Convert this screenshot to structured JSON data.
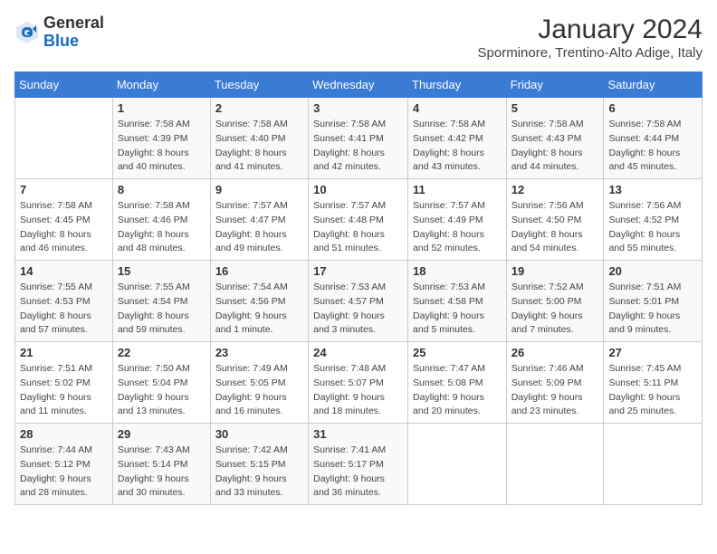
{
  "header": {
    "logo_line1": "General",
    "logo_line2": "Blue",
    "month_year": "January 2024",
    "location": "Sporminore, Trentino-Alto Adige, Italy"
  },
  "days_of_week": [
    "Sunday",
    "Monday",
    "Tuesday",
    "Wednesday",
    "Thursday",
    "Friday",
    "Saturday"
  ],
  "weeks": [
    [
      {
        "day": "",
        "sunrise": "",
        "sunset": "",
        "daylight": ""
      },
      {
        "day": "1",
        "sunrise": "7:58 AM",
        "sunset": "4:39 PM",
        "daylight": "8 hours and 40 minutes."
      },
      {
        "day": "2",
        "sunrise": "7:58 AM",
        "sunset": "4:40 PM",
        "daylight": "8 hours and 41 minutes."
      },
      {
        "day": "3",
        "sunrise": "7:58 AM",
        "sunset": "4:41 PM",
        "daylight": "8 hours and 42 minutes."
      },
      {
        "day": "4",
        "sunrise": "7:58 AM",
        "sunset": "4:42 PM",
        "daylight": "8 hours and 43 minutes."
      },
      {
        "day": "5",
        "sunrise": "7:58 AM",
        "sunset": "4:43 PM",
        "daylight": "8 hours and 44 minutes."
      },
      {
        "day": "6",
        "sunrise": "7:58 AM",
        "sunset": "4:44 PM",
        "daylight": "8 hours and 45 minutes."
      }
    ],
    [
      {
        "day": "7",
        "sunrise": "7:58 AM",
        "sunset": "4:45 PM",
        "daylight": "8 hours and 46 minutes."
      },
      {
        "day": "8",
        "sunrise": "7:58 AM",
        "sunset": "4:46 PM",
        "daylight": "8 hours and 48 minutes."
      },
      {
        "day": "9",
        "sunrise": "7:57 AM",
        "sunset": "4:47 PM",
        "daylight": "8 hours and 49 minutes."
      },
      {
        "day": "10",
        "sunrise": "7:57 AM",
        "sunset": "4:48 PM",
        "daylight": "8 hours and 51 minutes."
      },
      {
        "day": "11",
        "sunrise": "7:57 AM",
        "sunset": "4:49 PM",
        "daylight": "8 hours and 52 minutes."
      },
      {
        "day": "12",
        "sunrise": "7:56 AM",
        "sunset": "4:50 PM",
        "daylight": "8 hours and 54 minutes."
      },
      {
        "day": "13",
        "sunrise": "7:56 AM",
        "sunset": "4:52 PM",
        "daylight": "8 hours and 55 minutes."
      }
    ],
    [
      {
        "day": "14",
        "sunrise": "7:55 AM",
        "sunset": "4:53 PM",
        "daylight": "8 hours and 57 minutes."
      },
      {
        "day": "15",
        "sunrise": "7:55 AM",
        "sunset": "4:54 PM",
        "daylight": "8 hours and 59 minutes."
      },
      {
        "day": "16",
        "sunrise": "7:54 AM",
        "sunset": "4:56 PM",
        "daylight": "9 hours and 1 minute."
      },
      {
        "day": "17",
        "sunrise": "7:53 AM",
        "sunset": "4:57 PM",
        "daylight": "9 hours and 3 minutes."
      },
      {
        "day": "18",
        "sunrise": "7:53 AM",
        "sunset": "4:58 PM",
        "daylight": "9 hours and 5 minutes."
      },
      {
        "day": "19",
        "sunrise": "7:52 AM",
        "sunset": "5:00 PM",
        "daylight": "9 hours and 7 minutes."
      },
      {
        "day": "20",
        "sunrise": "7:51 AM",
        "sunset": "5:01 PM",
        "daylight": "9 hours and 9 minutes."
      }
    ],
    [
      {
        "day": "21",
        "sunrise": "7:51 AM",
        "sunset": "5:02 PM",
        "daylight": "9 hours and 11 minutes."
      },
      {
        "day": "22",
        "sunrise": "7:50 AM",
        "sunset": "5:04 PM",
        "daylight": "9 hours and 13 minutes."
      },
      {
        "day": "23",
        "sunrise": "7:49 AM",
        "sunset": "5:05 PM",
        "daylight": "9 hours and 16 minutes."
      },
      {
        "day": "24",
        "sunrise": "7:48 AM",
        "sunset": "5:07 PM",
        "daylight": "9 hours and 18 minutes."
      },
      {
        "day": "25",
        "sunrise": "7:47 AM",
        "sunset": "5:08 PM",
        "daylight": "9 hours and 20 minutes."
      },
      {
        "day": "26",
        "sunrise": "7:46 AM",
        "sunset": "5:09 PM",
        "daylight": "9 hours and 23 minutes."
      },
      {
        "day": "27",
        "sunrise": "7:45 AM",
        "sunset": "5:11 PM",
        "daylight": "9 hours and 25 minutes."
      }
    ],
    [
      {
        "day": "28",
        "sunrise": "7:44 AM",
        "sunset": "5:12 PM",
        "daylight": "9 hours and 28 minutes."
      },
      {
        "day": "29",
        "sunrise": "7:43 AM",
        "sunset": "5:14 PM",
        "daylight": "9 hours and 30 minutes."
      },
      {
        "day": "30",
        "sunrise": "7:42 AM",
        "sunset": "5:15 PM",
        "daylight": "9 hours and 33 minutes."
      },
      {
        "day": "31",
        "sunrise": "7:41 AM",
        "sunset": "5:17 PM",
        "daylight": "9 hours and 36 minutes."
      },
      {
        "day": "",
        "sunrise": "",
        "sunset": "",
        "daylight": ""
      },
      {
        "day": "",
        "sunrise": "",
        "sunset": "",
        "daylight": ""
      },
      {
        "day": "",
        "sunrise": "",
        "sunset": "",
        "daylight": ""
      }
    ]
  ]
}
